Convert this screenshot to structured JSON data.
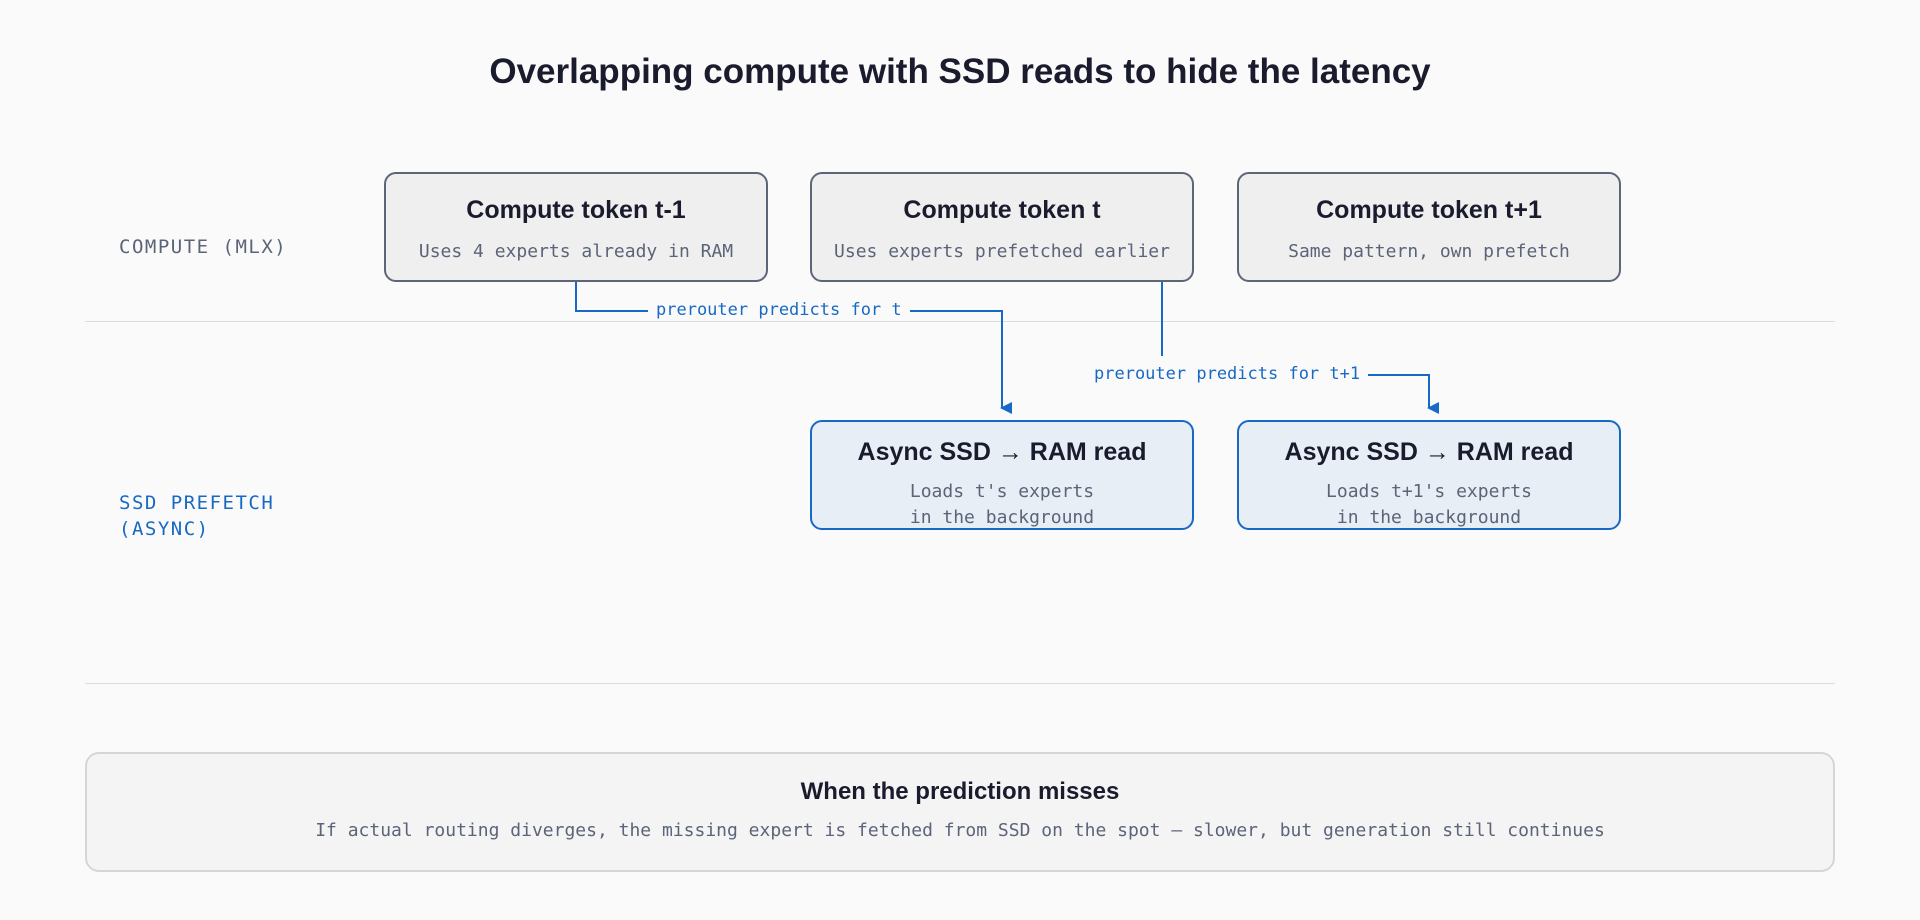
{
  "title": "Overlapping compute with SSD reads to hide the latency",
  "lanes": {
    "compute": "COMPUTE (MLX)",
    "ssd_line1": "SSD PREFETCH",
    "ssd_line2": "(ASYNC)"
  },
  "compute_boxes": [
    {
      "title": "Compute token t-1",
      "subtitle": "Uses 4 experts already in RAM"
    },
    {
      "title": "Compute token t",
      "subtitle": "Uses experts prefetched earlier"
    },
    {
      "title": "Compute token t+1",
      "subtitle": "Same pattern, own prefetch"
    }
  ],
  "ssd_boxes": [
    {
      "title": "Async SSD → RAM read",
      "line1": "Loads t's experts",
      "line2": "in the background"
    },
    {
      "title": "Async SSD → RAM read",
      "line1": "Loads t+1's experts",
      "line2": "in the background"
    }
  ],
  "arrows": [
    {
      "label": "prerouter predicts for t"
    },
    {
      "label": "prerouter predicts for t+1"
    }
  ],
  "note": {
    "title": "When the prediction misses",
    "text": "If actual routing diverges, the missing expert is fetched from SSD on the spot — slower, but generation still continues"
  },
  "colors": {
    "accent": "#1769c4",
    "text": "#1a1c2e",
    "muted": "#5b6478"
  }
}
